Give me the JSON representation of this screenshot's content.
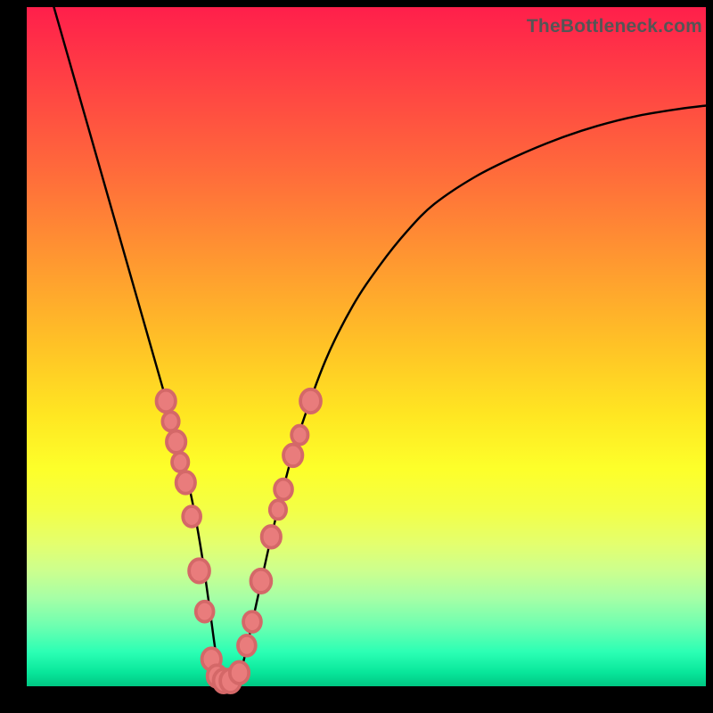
{
  "watermark": "TheBottleneck.com",
  "chart_data": {
    "type": "line",
    "title": "",
    "xlabel": "",
    "ylabel": "",
    "xlim": [
      0,
      100
    ],
    "ylim": [
      0,
      100
    ],
    "series": [
      {
        "name": "bottleneck-curve",
        "x": [
          4,
          6,
          8,
          10,
          12,
          14,
          16,
          18,
          20,
          22,
          23,
          24,
          25,
          26,
          27,
          28,
          29,
          30,
          31,
          32,
          34,
          36,
          38,
          40,
          44,
          48,
          52,
          56,
          60,
          66,
          72,
          78,
          84,
          90,
          96,
          100
        ],
        "values": [
          100,
          93,
          86,
          79,
          72,
          65,
          58,
          51,
          44,
          37,
          33,
          29,
          24,
          18,
          11,
          4,
          1,
          0,
          1,
          4,
          13,
          22,
          30,
          37,
          48,
          56,
          62,
          67,
          71,
          75,
          78,
          80.5,
          82.5,
          84,
          85,
          85.5
        ]
      }
    ],
    "markers": {
      "name": "highlight-dots",
      "points": [
        {
          "x": 20.5,
          "y": 42,
          "r": 1.4
        },
        {
          "x": 21.2,
          "y": 39,
          "r": 1.2
        },
        {
          "x": 22.0,
          "y": 36,
          "r": 1.4
        },
        {
          "x": 22.6,
          "y": 33,
          "r": 1.2
        },
        {
          "x": 23.4,
          "y": 30,
          "r": 1.4
        },
        {
          "x": 24.3,
          "y": 25,
          "r": 1.3
        },
        {
          "x": 25.4,
          "y": 17,
          "r": 1.5
        },
        {
          "x": 26.2,
          "y": 11,
          "r": 1.3
        },
        {
          "x": 27.2,
          "y": 4,
          "r": 1.4
        },
        {
          "x": 28.0,
          "y": 1.5,
          "r": 1.4
        },
        {
          "x": 29.0,
          "y": 0.8,
          "r": 1.5
        },
        {
          "x": 30.0,
          "y": 0.8,
          "r": 1.5
        },
        {
          "x": 31.3,
          "y": 2,
          "r": 1.4
        },
        {
          "x": 32.4,
          "y": 6,
          "r": 1.3
        },
        {
          "x": 33.2,
          "y": 9.5,
          "r": 1.3
        },
        {
          "x": 34.5,
          "y": 15.5,
          "r": 1.5
        },
        {
          "x": 36.0,
          "y": 22,
          "r": 1.4
        },
        {
          "x": 37.0,
          "y": 26,
          "r": 1.2
        },
        {
          "x": 37.8,
          "y": 29,
          "r": 1.3
        },
        {
          "x": 39.2,
          "y": 34,
          "r": 1.4
        },
        {
          "x": 40.2,
          "y": 37,
          "r": 1.2
        },
        {
          "x": 41.8,
          "y": 42,
          "r": 1.5
        }
      ]
    }
  }
}
